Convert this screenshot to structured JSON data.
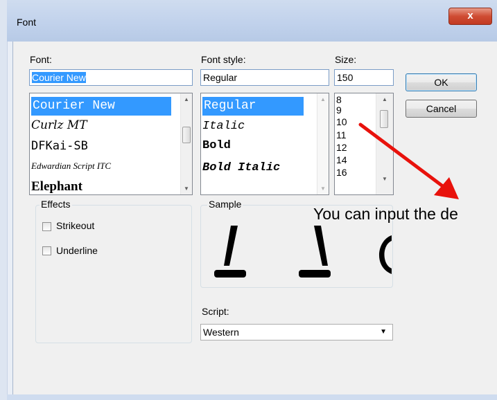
{
  "window": {
    "title": "Font",
    "close_glyph": "x"
  },
  "font": {
    "label": "Font:",
    "value": "Courier New",
    "items": [
      "Courier New",
      "Curlz MT",
      "DFKai-SB",
      "Edwardian Script ITC",
      "Elephant"
    ]
  },
  "style": {
    "label": "Font style:",
    "value": "Regular",
    "items": [
      "Regular",
      "Italic",
      "Bold",
      "Bold Italic"
    ]
  },
  "size": {
    "label": "Size:",
    "value": "150",
    "items": [
      "8",
      "9",
      "10",
      "11",
      "12",
      "14",
      "16"
    ]
  },
  "buttons": {
    "ok": "OK",
    "cancel": "Cancel"
  },
  "effects": {
    "label": "Effects",
    "strikeout": "Strikeout",
    "underline": "Underline"
  },
  "sample": {
    "label": "Sample"
  },
  "script": {
    "label": "Script:",
    "value": "Western"
  },
  "annotation": {
    "text": "You can input the de",
    "arrow_color": "#e8120c"
  },
  "colors": {
    "selection": "#3399ff",
    "close_button": "#c94530"
  }
}
